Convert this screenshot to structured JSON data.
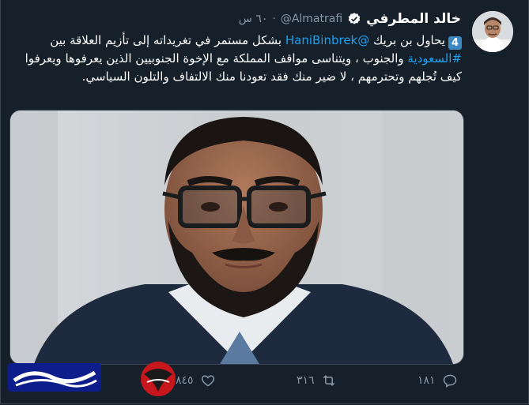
{
  "tweet": {
    "display_name": "خالد المطرفي",
    "handle": "@Almatrafi",
    "time": "٦٠ س",
    "number_emoji": "4",
    "text_part1": "يحاول بن بريك ",
    "mention": "@HaniBinbrek",
    "text_part2": " بشكل مستمر في تغريداته إلى تأزيم العلاقة بين ",
    "hashtag": "#السعودية",
    "text_part3": " والجنوب ، ويتناسى مواقف المملكة مع الإخوة الجنوبيين الذين يعرفوها ويعرفوا كيف تُجلهم وتحترمهم ، لا ضير منك فقد تعودنا منك الالتفاف والتلون السياسي."
  },
  "actions": {
    "reply_count": "١٨١",
    "retweet_count": "٣١٦",
    "like_count": "٨٤٥"
  },
  "colors": {
    "background": "#15202b",
    "link": "#1da1f2",
    "muted": "#8899a6",
    "verified": "#ffffff"
  },
  "icons": {
    "verified": "verified-badge-icon",
    "reply": "reply-icon",
    "retweet": "retweet-icon",
    "like": "heart-icon"
  }
}
